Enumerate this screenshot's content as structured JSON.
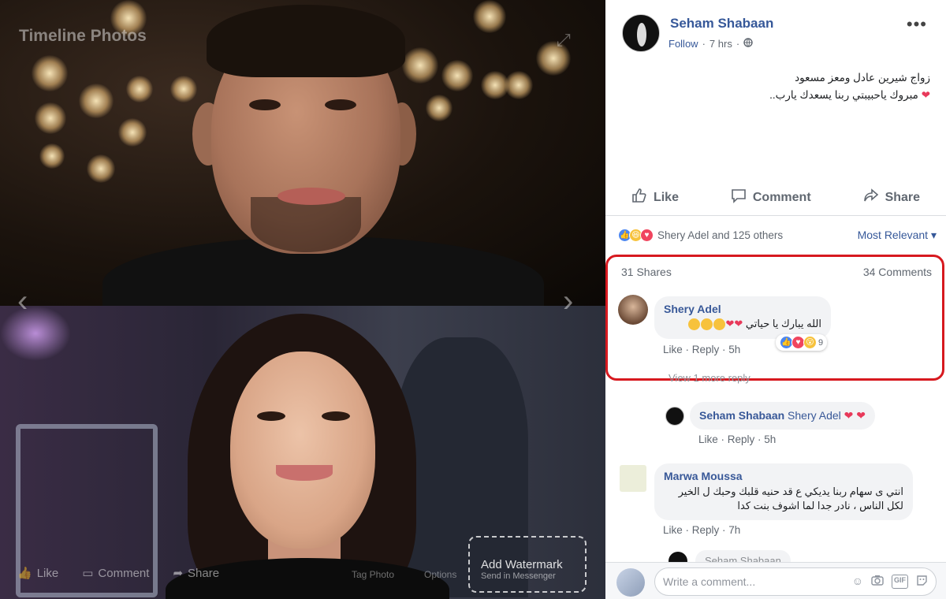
{
  "photo": {
    "label": "Timeline Photos",
    "actions": {
      "like": "Like",
      "comment": "Comment",
      "share": "Share",
      "tag_photo": "Tag Photo",
      "options": "Options"
    },
    "watermark": {
      "title": "Add Watermark",
      "subtitle": "Send in Messenger"
    }
  },
  "post": {
    "author": "Seham Shabaan",
    "follow": "Follow",
    "time": "7 hrs",
    "line1": "زواج شيرين عادل ومعز مسعود",
    "line2": "مبروك ياحبيبتي ربنا يسعدك يارب.."
  },
  "actions": {
    "like": "Like",
    "comment": "Comment",
    "share": "Share"
  },
  "reactions": {
    "summary": "Shery Adel and 125 others",
    "sort": "Most Relevant"
  },
  "stats": {
    "shares": "31 Shares",
    "comments": "34 Comments"
  },
  "comments": [
    {
      "name": "Shery Adel",
      "text": "الله يبارك يا حياتي",
      "reaction_count": "9",
      "like": "Like",
      "reply": "Reply",
      "time": "5h"
    },
    {
      "name": "Seham Shabaan",
      "mention": "Shery Adel",
      "like": "Like",
      "reply": "Reply",
      "time": "5h"
    },
    {
      "name": "Marwa Moussa",
      "text": "انتي ى سهام ربنا يديكي ع قد حنيه قلبك وحبك ل الخير لكل الناس ، نادر جدا لما اشوف بنت كدا",
      "like": "Like",
      "reply": "Reply",
      "time": "7h"
    }
  ],
  "view_replies": "View 1 more reply",
  "peek_comment_name": "Seham Shabaan",
  "composer": {
    "placeholder": "Write a comment...",
    "gif": "GIF"
  },
  "colors": {
    "link": "#365899",
    "highlight": "#d7191f",
    "heart": "#e8395a"
  }
}
